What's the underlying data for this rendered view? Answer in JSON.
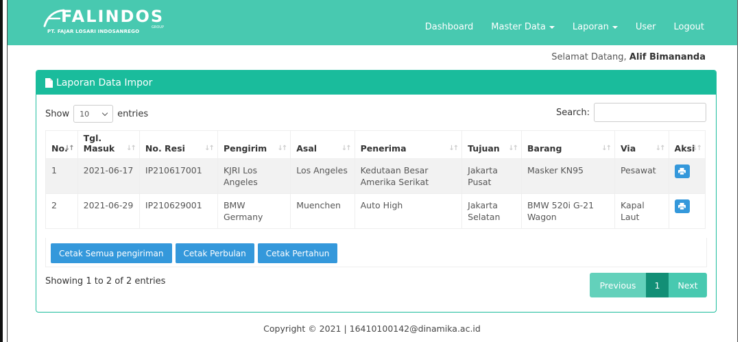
{
  "brand": {
    "name": "FALINDOS",
    "group": "GROUP",
    "subtitle": "PT. FAJAR LOSARI INDOSANREGO"
  },
  "nav": {
    "items": [
      {
        "label": "Dashboard",
        "dropdown": false
      },
      {
        "label": "Master Data",
        "dropdown": true
      },
      {
        "label": "Laporan",
        "dropdown": true
      },
      {
        "label": "User",
        "dropdown": false
      },
      {
        "label": "Logout",
        "dropdown": false
      }
    ]
  },
  "welcome": {
    "prefix": "Selamat Datang,",
    "user": "Alif Bimananda"
  },
  "panel": {
    "title": "Laporan Data Impor"
  },
  "length": {
    "show": "Show",
    "value": "10",
    "entries": "entries"
  },
  "search": {
    "label": "Search:",
    "value": ""
  },
  "table": {
    "headers": [
      "No.",
      "Tgl. Masuk",
      "No. Resi",
      "Pengirim",
      "Asal",
      "Penerima",
      "Tujuan",
      "Barang",
      "Via",
      "Aksi"
    ],
    "rows": [
      [
        "1",
        "2021-06-17",
        "IP210617001",
        "KJRI Los Angeles",
        "Los Angeles",
        "Kedutaan Besar Amerika Serikat",
        "Jakarta Pusat",
        "Masker KN95",
        "Pesawat"
      ],
      [
        "2",
        "2021-06-29",
        "IP210629001",
        "BMW Germany",
        "Muenchen",
        "Auto High",
        "Jakarta Selatan",
        "BMW 520i G-21 Wagon",
        "Kapal Laut"
      ]
    ]
  },
  "buttons": {
    "all": "Cetak Semua pengiriman",
    "monthly": "Cetak Perbulan",
    "yearly": "Cetak Pertahun"
  },
  "info": "Showing 1 to 2 of 2 entries",
  "pager": {
    "previous": "Previous",
    "current": "1",
    "next": "Next"
  },
  "footer": "Copyright © 2021 | 16410100142@dinamika.ac.id",
  "colors": {
    "navbar": "#48c9b0",
    "panel_header": "#1abc9c",
    "button": "#3498db",
    "pager_active": "#128f76"
  }
}
